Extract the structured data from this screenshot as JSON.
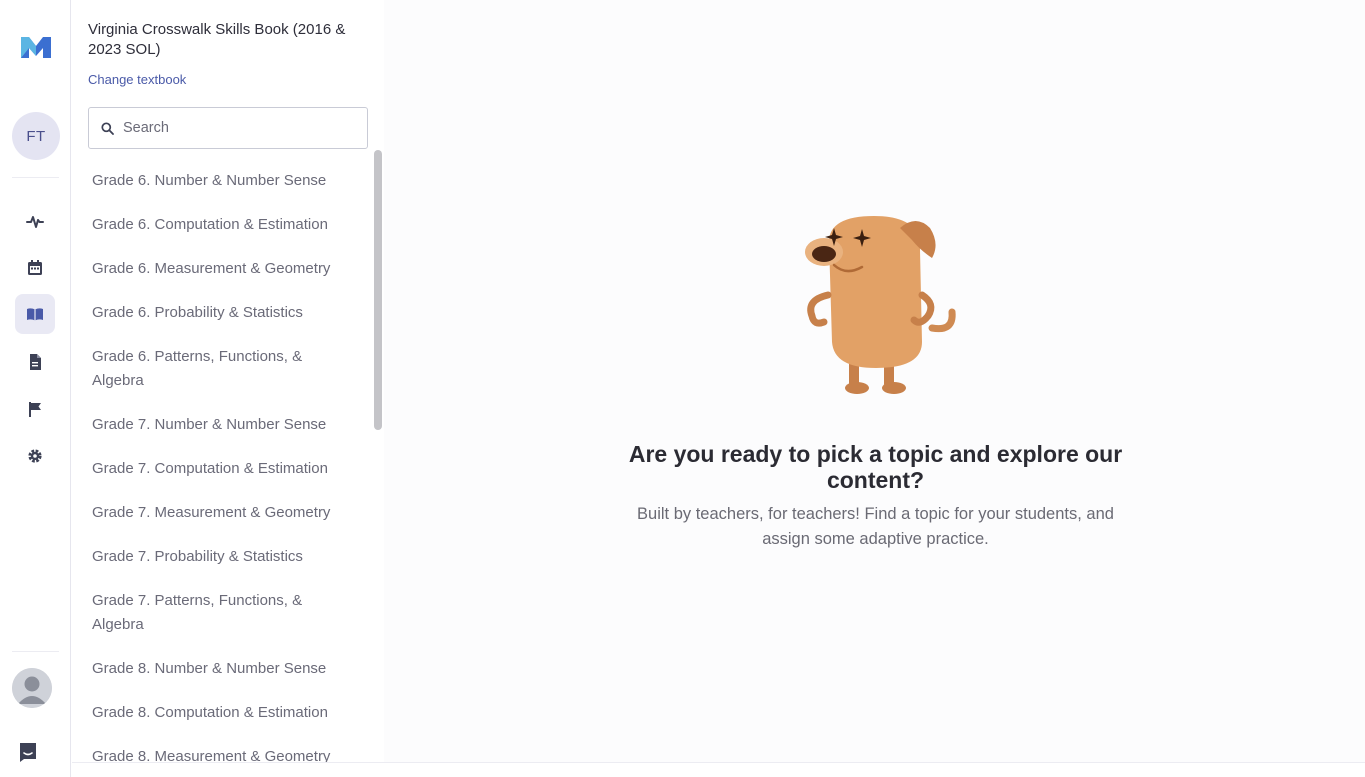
{
  "rail": {
    "initials": "FT",
    "icons": [
      "logo-icon",
      "activity-icon",
      "calendar-icon",
      "book-icon",
      "document-icon",
      "flag-icon",
      "gear-icon",
      "user-avatar-icon",
      "chat-icon"
    ],
    "accent": "#4a5aa8"
  },
  "sidebar": {
    "book_title": "Virginia Crosswalk Skills Book (2016 & 2023 SOL)",
    "change_link": "Change textbook",
    "search_placeholder": "Search",
    "topics": [
      "Grade 6. Number & Number Sense",
      "Grade 6. Computation & Estimation",
      "Grade 6. Measurement & Geometry",
      "Grade 6. Probability & Statistics",
      "Grade 6. Patterns, Functions, & Algebra",
      "Grade 7. Number & Number Sense",
      "Grade 7. Computation & Estimation",
      "Grade 7. Measurement & Geometry",
      "Grade 7. Probability & Statistics",
      "Grade 7. Patterns, Functions, & Algebra",
      "Grade 8. Number & Number Sense",
      "Grade 8. Computation & Estimation",
      "Grade 8. Measurement & Geometry"
    ]
  },
  "main": {
    "headline": "Are you ready to pick a topic and explore our content?",
    "subtext": "Built by teachers, for teachers! Find a topic for your students, and assign some adaptive practice."
  }
}
